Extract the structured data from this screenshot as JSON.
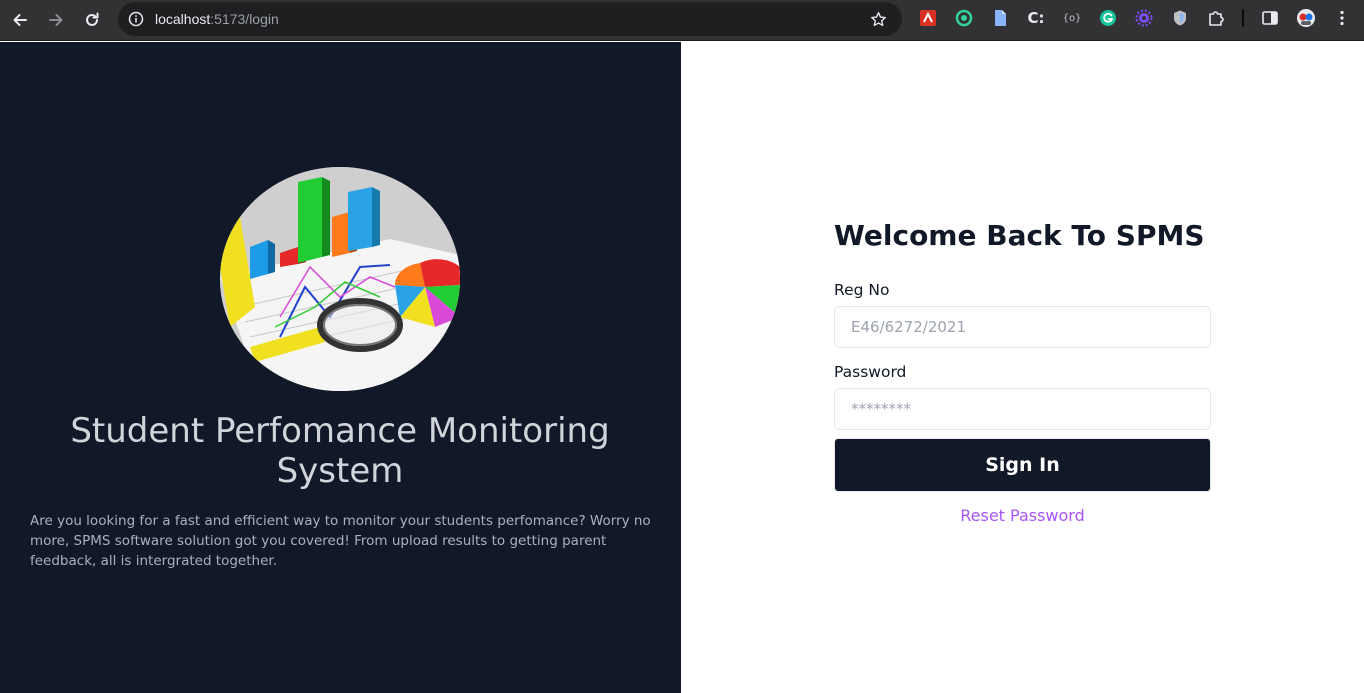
{
  "browser": {
    "url_host": "localhost",
    "url_path": ":5173/login",
    "icons": {
      "back": "back-arrow-icon",
      "forward": "forward-arrow-icon",
      "reload": "reload-icon",
      "site_info": "site-info-icon",
      "bookmark": "star-icon",
      "extensions": [
        "red-extension-icon",
        "green-ring-extension-icon",
        "document-extension-icon",
        "c-colon-extension-icon",
        "code-extension-icon",
        "grammarly-icon",
        "purple-gear-extension-icon",
        "shield-extension-icon",
        "puzzle-extensions-icon"
      ],
      "side_panel": "side-panel-icon",
      "profile": "profile-avatar-icon",
      "menu": "kebab-menu-icon"
    }
  },
  "left_panel": {
    "title": "Student Perfomance Monitoring System",
    "description": "Are you looking for a fast and efficient way to monitor your students perfomance? Worry no more, SPMS software solution got you covered! From upload results to getting parent feedback, all is intergrated together.",
    "background": "#111827"
  },
  "login": {
    "heading": "Welcome Back To SPMS",
    "reg_no": {
      "label": "Reg No",
      "placeholder": "E46/6272/2021",
      "value": ""
    },
    "password": {
      "label": "Password",
      "placeholder": "********",
      "value": ""
    },
    "sign_in_label": "Sign In",
    "reset_label": "Reset Password"
  },
  "colors": {
    "primary": "#111827",
    "link": "#a855f7",
    "input_border": "#e5e7eb"
  }
}
